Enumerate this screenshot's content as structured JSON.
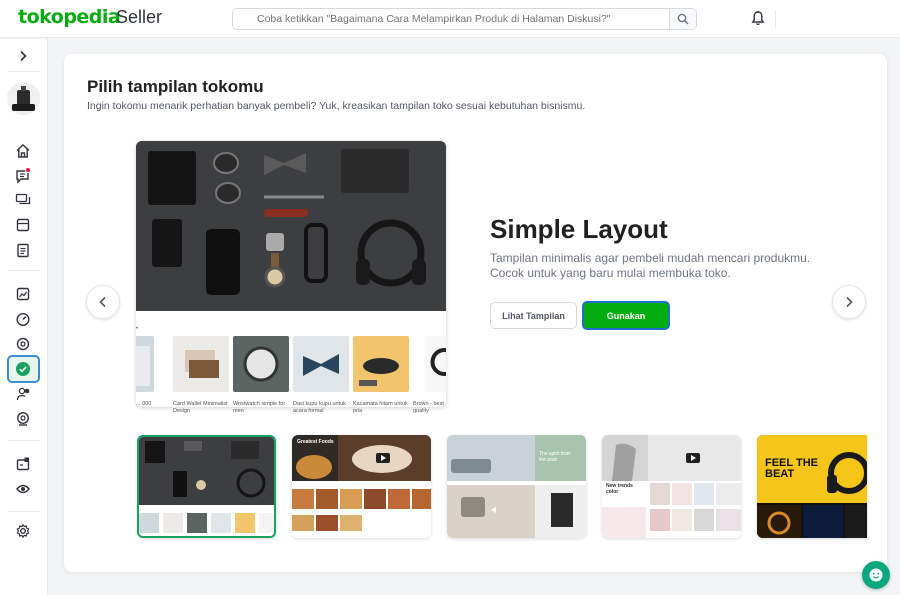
{
  "header": {
    "logo": "tokopedia",
    "logo_suffix": "Seller",
    "search_placeholder": "Coba ketikkan \"Bagaimana Cara Melampirkan Produk di Halaman Diskusi?\""
  },
  "page": {
    "title": "Pilih tampilan tokomu",
    "subtitle": "Ingin tokomu menarik perhatian banyak pembeli? Yuk, kreasikan tampilan toko sesuai kebutuhan bisnismu."
  },
  "layout": {
    "name": "Simple Layout",
    "description": "Tampilan minimalis agar pembeli mudah mencari produkmu. Cocok untuk yang baru mulai membuka toko.",
    "preview_button": "Lihat Tampilan",
    "use_button": "Gunakan"
  },
  "preview_products": [
    {
      "caption": "...\n000"
    },
    {
      "caption": "Card Wallet Minimalist Design"
    },
    {
      "caption": "Wristwatch simple for men"
    },
    {
      "caption": "Dasi kupu kupu untuk acara formal"
    },
    {
      "caption": "Kacamata hitam untuk pria"
    },
    {
      "caption": "Brown - best quality"
    }
  ],
  "thumbnails": [
    {
      "name": "Simple Layout",
      "selected": true,
      "text": ""
    },
    {
      "name": "Food Layout",
      "selected": false,
      "text": "Greatest Foods"
    },
    {
      "name": "Furniture Layout",
      "selected": false,
      "text": "The spirit from the past"
    },
    {
      "name": "Fashion Layout",
      "selected": false,
      "text": "New trends color"
    },
    {
      "name": "Music Layout",
      "selected": false,
      "text": "FEEL THE BEAT"
    }
  ],
  "colors": {
    "brand": "#03ac0e",
    "active_border": "#3a8fd4",
    "notification": "#ef144a"
  }
}
